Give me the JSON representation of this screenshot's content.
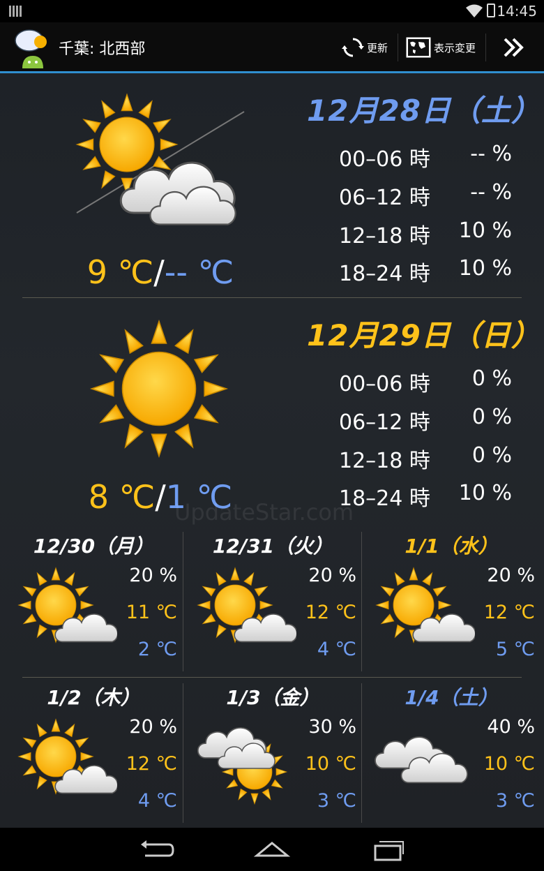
{
  "status_bar": {
    "time": "14:45"
  },
  "action_bar": {
    "title": "千葉: 北西部",
    "refresh_label": "更新",
    "display_change_label": "表示変更"
  },
  "watermark": "UpdateStar.com",
  "days": [
    {
      "date": "12月28日（土）",
      "date_color": "#6f9cf0",
      "icon": "sun-behind-clouds-icon",
      "temp_high": "9 ℃",
      "temp_sep": "/",
      "temp_low": "-- ℃",
      "rain": [
        {
          "range": "00–06 時",
          "pct": "-- %"
        },
        {
          "range": "06–12 時",
          "pct": "-- %"
        },
        {
          "range": "12–18 時",
          "pct": "10 %"
        },
        {
          "range": "18–24 時",
          "pct": "10 %"
        }
      ]
    },
    {
      "date": "12月29日（日）",
      "date_color": "#ffc21a",
      "icon": "sun-icon",
      "temp_high": "8 ℃",
      "temp_sep": "/",
      "temp_low": "1 ℃",
      "rain": [
        {
          "range": "00–06 時",
          "pct": "0 %"
        },
        {
          "range": "06–12 時",
          "pct": "0 %"
        },
        {
          "range": "12–18 時",
          "pct": "0 %"
        },
        {
          "range": "18–24 時",
          "pct": "10 %"
        }
      ]
    }
  ],
  "forecast": [
    {
      "date": "12/30（月）",
      "date_color": "#ffffff",
      "icon": "sun-with-cloud-icon",
      "rain": "20 %",
      "high": "11 ℃",
      "low": "2 ℃"
    },
    {
      "date": "12/31（火）",
      "date_color": "#ffffff",
      "icon": "sun-with-cloud-icon",
      "rain": "20 %",
      "high": "12 ℃",
      "low": "4 ℃"
    },
    {
      "date": "1/1（水）",
      "date_color": "#ffc21a",
      "icon": "sun-with-cloud-icon",
      "rain": "20 %",
      "high": "12 ℃",
      "low": "5 ℃"
    },
    {
      "date": "1/2（木）",
      "date_color": "#ffffff",
      "icon": "sun-with-cloud-icon",
      "rain": "20 %",
      "high": "12 ℃",
      "low": "4 ℃"
    },
    {
      "date": "1/3（金）",
      "date_color": "#ffffff",
      "icon": "clouds-then-sun-icon",
      "rain": "30 %",
      "high": "10 ℃",
      "low": "3 ℃"
    },
    {
      "date": "1/4（土）",
      "date_color": "#6f9cf0",
      "icon": "cloud-icon",
      "rain": "40 %",
      "high": "10 ℃",
      "low": "3 ℃"
    }
  ]
}
